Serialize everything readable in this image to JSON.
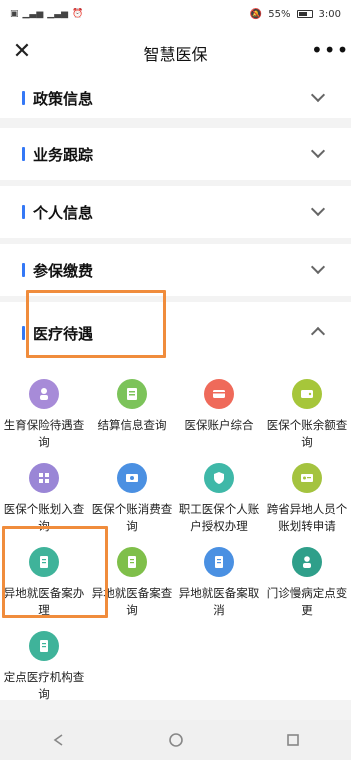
{
  "status": {
    "left_icons": [
      "sim-icon",
      "signal-icon",
      "signal-icon",
      "alarm-icon"
    ],
    "battery": "55%",
    "time": "3:00"
  },
  "header": {
    "title": "智慧医保",
    "close_icon": "close-icon",
    "more_icon": "more-icon"
  },
  "sections": [
    {
      "label": "政策信息",
      "expanded": false
    },
    {
      "label": "业务跟踪",
      "expanded": false
    },
    {
      "label": "个人信息",
      "expanded": false
    },
    {
      "label": "参保缴费",
      "expanded": false
    },
    {
      "label": "医疗待遇",
      "expanded": true
    }
  ],
  "services": [
    {
      "label": "生育保险待遇查询",
      "icon": "person-icon",
      "color": "#a78bd8"
    },
    {
      "label": "结算信息查询",
      "icon": "document-icon",
      "color": "#7cc35a"
    },
    {
      "label": "医保账户综合",
      "icon": "card-icon",
      "color": "#ef6a5a"
    },
    {
      "label": "医保个账余额查询",
      "icon": "wallet-icon",
      "color": "#a6c63a"
    },
    {
      "label": "医保个账划入查询",
      "icon": "grid-icon",
      "color": "#9a86d6"
    },
    {
      "label": "医保个账消费查询",
      "icon": "money-icon",
      "color": "#4b90e2"
    },
    {
      "label": "职工医保个人账户授权办理",
      "icon": "shield-icon",
      "color": "#3fb8a8"
    },
    {
      "label": "跨省异地人员个账划转申请",
      "icon": "id-card-icon",
      "color": "#a4c33f"
    },
    {
      "label": "异地就医备案办理",
      "icon": "file-icon",
      "color": "#3fb39a"
    },
    {
      "label": "异地就医备案查询",
      "icon": "file-icon",
      "color": "#7fbf4a"
    },
    {
      "label": "异地就医备案取消",
      "icon": "file-icon",
      "color": "#4a90e2"
    },
    {
      "label": "门诊慢病定点变更",
      "icon": "doctor-icon",
      "color": "#2f9f8a"
    },
    {
      "label": "定点医疗机构查询",
      "icon": "file-icon",
      "color": "#3fb39a"
    }
  ],
  "bottom_nav": [
    "back-icon",
    "home-icon",
    "recent-apps-icon"
  ]
}
